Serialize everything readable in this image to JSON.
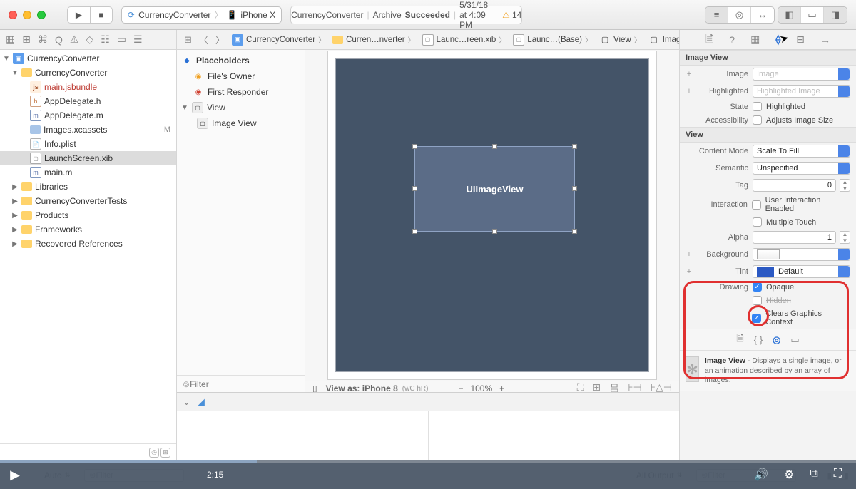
{
  "titlebar": {
    "scheme_app": "CurrencyConverter",
    "scheme_device": "iPhone X",
    "activity": {
      "project": "CurrencyConverter",
      "action": "Archive",
      "status": "Succeeded",
      "datetime": "5/31/18 at 4:09 PM",
      "warnings": "14"
    }
  },
  "breadcrumbs": [
    "CurrencyConverter",
    "Curren…nverter",
    "Launc…reen.xib",
    "Launc…(Base)",
    "View",
    "Image View"
  ],
  "project_tree": {
    "root": "CurrencyConverter",
    "group": "CurrencyConverter",
    "files": {
      "jsbundle": "main.jsbundle",
      "appdelegate_h": "AppDelegate.h",
      "appdelegate_m": "AppDelegate.m",
      "images": "Images.xcassets",
      "images_status": "M",
      "infoplist": "Info.plist",
      "launchscreen": "LaunchScreen.xib",
      "main_m": "main.m"
    },
    "groups": [
      "Libraries",
      "CurrencyConverterTests",
      "Products",
      "Frameworks",
      "Recovered References"
    ]
  },
  "outline": {
    "placeholders": "Placeholders",
    "files_owner": "File's Owner",
    "first_responder": "First Responder",
    "view": "View",
    "image_view": "Image View",
    "filter_placeholder": "Filter"
  },
  "canvas": {
    "selected_label": "UIImageView",
    "device_label": "View as: iPhone 8",
    "size_class": "(wC hR)",
    "zoom": "100%"
  },
  "inspector": {
    "section_image_view": "Image View",
    "image_label": "Image",
    "image_placeholder": "Image",
    "highlighted_label": "Highlighted",
    "highlighted_placeholder": "Highlighted Image",
    "state_label": "State",
    "state_highlighted": "Highlighted",
    "accessibility_label": "Accessibility",
    "adjusts_image_size": "Adjusts Image Size",
    "section_view": "View",
    "content_mode_label": "Content Mode",
    "content_mode_value": "Scale To Fill",
    "semantic_label": "Semantic",
    "semantic_value": "Unspecified",
    "tag_label": "Tag",
    "tag_value": "0",
    "interaction_label": "Interaction",
    "user_interaction": "User Interaction Enabled",
    "multiple_touch": "Multiple Touch",
    "alpha_label": "Alpha",
    "alpha_value": "1",
    "background_label": "Background",
    "tint_label": "Tint",
    "tint_value": "Default",
    "drawing_label": "Drawing",
    "opaque": "Opaque",
    "hidden": "Hidden",
    "clears_graphics": "Clears Graphics Context"
  },
  "library": {
    "item_title": "Image View",
    "item_desc": " - Displays a single image, or an animation described by an array of images."
  },
  "debug_bar": {
    "auto": "Auto",
    "filter": "Filter",
    "all_output": "All Output"
  },
  "player": {
    "time": "2:15"
  }
}
